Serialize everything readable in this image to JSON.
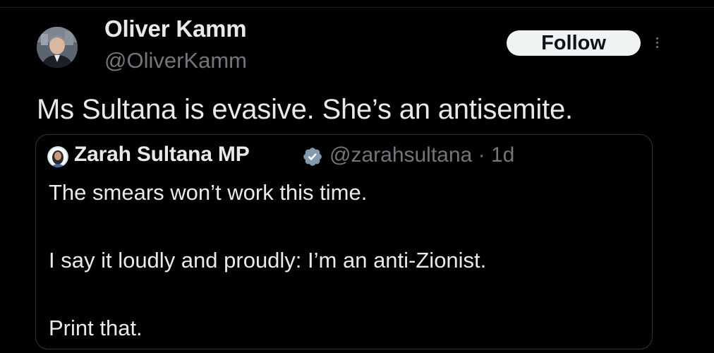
{
  "tweet": {
    "author": {
      "display_name": "Oliver Kamm",
      "handle": "@OliverKamm",
      "avatar_icon": "profile-photo"
    },
    "follow_label": "Follow",
    "more_icon": "more-vertical-icon",
    "text": "Ms Sultana is evasive. She’s an antisemite."
  },
  "quoted_tweet": {
    "author": {
      "display_name": "Zarah Sultana MP",
      "handle": "@zarahsultana",
      "verified_icon": "verified-badge-icon",
      "verified_color": "#829aab"
    },
    "separator": " · ",
    "age": "1d",
    "lines": [
      "The smears won’t work this time.",
      "I say it loudly and proudly: I’m an anti-Zionist.",
      "Print that."
    ]
  },
  "colors": {
    "background": "#000000",
    "primary_text": "#e7e9ea",
    "secondary_text": "#71767b",
    "border": "#2f3336",
    "follow_button_bg": "#eff3f4"
  }
}
